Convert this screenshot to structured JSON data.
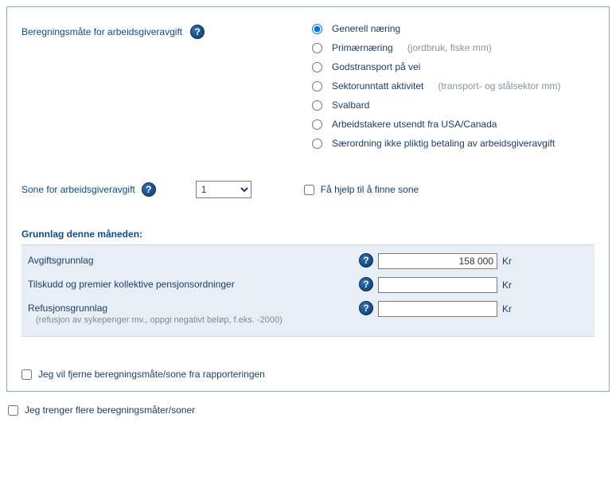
{
  "top": {
    "label": "Beregningsmåte for arbeidsgiveravgift"
  },
  "radios": [
    {
      "label": "Generell næring",
      "hint": "",
      "checked": true
    },
    {
      "label": "Primærnæring",
      "hint": "(jordbruk, fiske mm)",
      "checked": false
    },
    {
      "label": "Godstransport på vei",
      "hint": "",
      "checked": false
    },
    {
      "label": "Sektorunntatt aktivitet",
      "hint": "(transport- og stålsektor mm)",
      "checked": false
    },
    {
      "label": "Svalbard",
      "hint": "",
      "checked": false
    },
    {
      "label": "Arbeidstakere utsendt fra USA/Canada",
      "hint": "",
      "checked": false
    },
    {
      "label": "Særordning ikke pliktig betaling av arbeidsgiveravgift",
      "hint": "",
      "checked": false
    }
  ],
  "sone": {
    "label": "Sone for arbeidsgiveravgift",
    "value": "1",
    "help_label": "Få hjelp til å finne sone"
  },
  "grunnlag": {
    "heading": "Grunnlag denne måneden:",
    "rows": [
      {
        "label": "Avgiftsgrunnlag",
        "hint": "",
        "value": "158 000",
        "unit": "Kr"
      },
      {
        "label": "Tilskudd og premier kollektive pensjonsordninger",
        "hint": "",
        "value": "",
        "unit": "Kr"
      },
      {
        "label": "Refusjonsgrunnlag",
        "hint": "(refusjon av sykepenger mv., oppgi negativt beløp, f.eks. -2000)",
        "value": "",
        "unit": "Kr"
      }
    ]
  },
  "remove_chk": "Jeg vil fjerne beregningsmåte/sone fra rapporteringen",
  "more_chk": "Jeg trenger flere beregningsmåter/soner"
}
